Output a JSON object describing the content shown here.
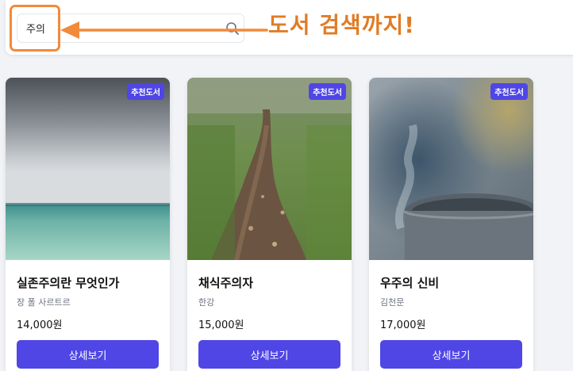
{
  "search": {
    "value": "주의"
  },
  "callout": {
    "text": "도서 검색까지!"
  },
  "cards": [
    {
      "badge": "추천도서",
      "title": "실존주의란 무엇인가",
      "author": "장 폴 사르트르",
      "price": "14,000원",
      "button": "상세보기"
    },
    {
      "badge": "추천도서",
      "title": "채식주의자",
      "author": "한강",
      "price": "15,000원",
      "button": "상세보기"
    },
    {
      "badge": "추천도서",
      "title": "우주의 신비",
      "author": "김천문",
      "price": "17,000원",
      "button": "상세보기"
    }
  ],
  "colors": {
    "accent": "#4f46e5",
    "annotation": "#f28a3b"
  }
}
